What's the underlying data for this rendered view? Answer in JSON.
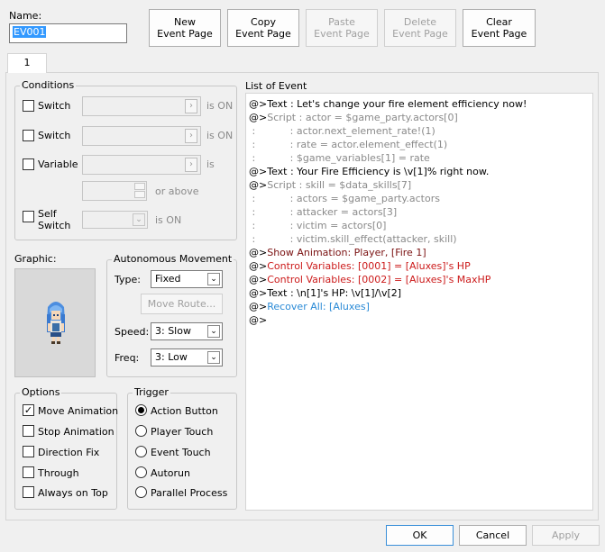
{
  "name_label": "Name:",
  "name_value": "EV001",
  "event_page_buttons": {
    "new": [
      "New",
      "Event Page"
    ],
    "copy": [
      "Copy",
      "Event Page"
    ],
    "paste": [
      "Paste",
      "Event Page"
    ],
    "delete": [
      "Delete",
      "Event Page"
    ],
    "clear": [
      "Clear",
      "Event Page"
    ]
  },
  "tab_label": "1",
  "conditions": {
    "title": "Conditions",
    "switch1": {
      "label": "Switch",
      "suffix": "is ON"
    },
    "switch2": {
      "label": "Switch",
      "suffix": "is ON"
    },
    "variable": {
      "label": "Variable",
      "suffix": "is",
      "or_above": "or above"
    },
    "self_switch": {
      "label1": "Self",
      "label2": "Switch",
      "suffix": "is ON"
    }
  },
  "graphic_label": "Graphic:",
  "autonomous": {
    "title": "Autonomous Movement",
    "type_label": "Type:",
    "type_value": "Fixed",
    "move_route": "Move Route...",
    "speed_label": "Speed:",
    "speed_value": "3: Slow",
    "freq_label": "Freq:",
    "freq_value": "3: Low"
  },
  "options": {
    "title": "Options",
    "items": [
      {
        "label": "Move Animation",
        "checked": true
      },
      {
        "label": "Stop Animation",
        "checked": false
      },
      {
        "label": "Direction Fix",
        "checked": false
      },
      {
        "label": "Through",
        "checked": false
      },
      {
        "label": "Always on Top",
        "checked": false
      }
    ]
  },
  "trigger": {
    "title": "Trigger",
    "items": [
      {
        "label": "Action Button",
        "selected": true
      },
      {
        "label": "Player Touch",
        "selected": false
      },
      {
        "label": "Event Touch",
        "selected": false
      },
      {
        "label": "Autorun",
        "selected": false
      },
      {
        "label": "Parallel Process",
        "selected": false
      }
    ]
  },
  "list_title": "List of Event",
  "event_lines": [
    [
      {
        "t": "@>",
        "c": "k"
      },
      {
        "t": "Text : Let's change your fire element efficiency now!",
        "c": "k"
      }
    ],
    [
      {
        "t": "@>",
        "c": "k"
      },
      {
        "t": "Script : actor = $game_party.actors[0]",
        "c": "g"
      }
    ],
    [
      {
        "t": " :           : actor.next_element_rate!(1)",
        "c": "g"
      }
    ],
    [
      {
        "t": " :           : rate = actor.element_effect(1)",
        "c": "g"
      }
    ],
    [
      {
        "t": " :           : $game_variables[1] = rate",
        "c": "g"
      }
    ],
    [
      {
        "t": "@>",
        "c": "k"
      },
      {
        "t": "Text : Your Fire Efficiency is \\v[1]% right now.",
        "c": "k"
      }
    ],
    [
      {
        "t": "@>",
        "c": "k"
      },
      {
        "t": "Script : skill = $data_skills[7]",
        "c": "g"
      }
    ],
    [
      {
        "t": " :           : actors = $game_party.actors",
        "c": "g"
      }
    ],
    [
      {
        "t": " :           : attacker = actors[3]",
        "c": "g"
      }
    ],
    [
      {
        "t": " :           : victim = actors[0]",
        "c": "g"
      }
    ],
    [
      {
        "t": " :           : victim.skill_effect(attacker, skill)",
        "c": "g"
      }
    ],
    [
      {
        "t": "@>",
        "c": "k"
      },
      {
        "t": "Show Animation: Player, [Fire 1]",
        "c": "d"
      }
    ],
    [
      {
        "t": "@>",
        "c": "k"
      },
      {
        "t": "Control Variables: [0001] = [Aluxes]'s HP",
        "c": "r"
      }
    ],
    [
      {
        "t": "@>",
        "c": "k"
      },
      {
        "t": "Control Variables: [0002] = [Aluxes]'s MaxHP",
        "c": "r"
      }
    ],
    [
      {
        "t": "@>",
        "c": "k"
      },
      {
        "t": "Text : \\n[1]'s HP: \\v[1]/\\v[2]",
        "c": "k"
      }
    ],
    [
      {
        "t": "@>",
        "c": "k"
      },
      {
        "t": "Recover All: [Aluxes]",
        "c": "b"
      }
    ],
    [
      {
        "t": "@>",
        "c": "k"
      }
    ]
  ],
  "footer": {
    "ok": "OK",
    "cancel": "Cancel",
    "apply": "Apply"
  },
  "icons": {
    "checkmark": "✓",
    "ellipsis": "›",
    "dropdown": "⌄"
  },
  "colors": {
    "selection": "#3399ff",
    "script_gray": "#8a8a8a",
    "red": "#cc1a1a",
    "blue": "#2a8ad6"
  }
}
